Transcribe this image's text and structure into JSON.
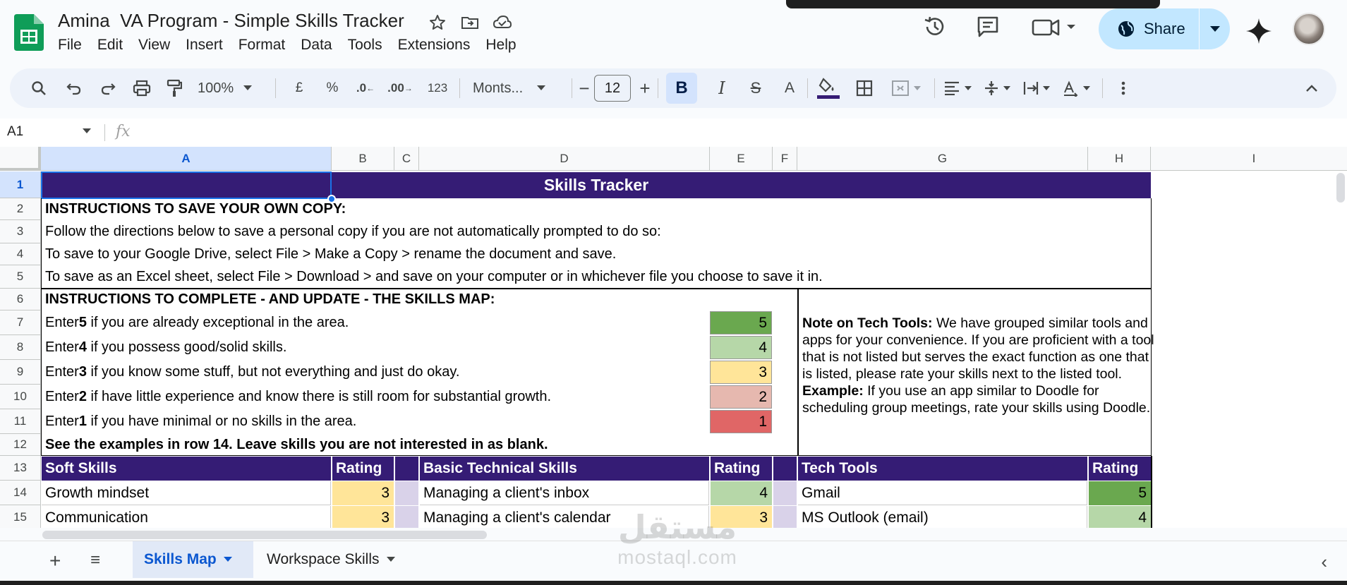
{
  "app": {
    "title": "Amina  VA Program - Simple Skills Tracker",
    "menu": [
      "File",
      "Edit",
      "View",
      "Insert",
      "Format",
      "Data",
      "Tools",
      "Extensions",
      "Help"
    ],
    "share_label": "Share"
  },
  "toolbar": {
    "zoom": "100%",
    "currency": "£",
    "percent": "%",
    "dec_less": ".0",
    "dec_more": ".00",
    "number_format": "123",
    "font": "Monts...",
    "font_size": "12",
    "bold": "B",
    "italic": "I",
    "strike": "S",
    "textcolor": "A"
  },
  "formula": {
    "name_box": "A1",
    "fx": "fx",
    "content": ""
  },
  "columns": [
    "A",
    "B",
    "C",
    "D",
    "E",
    "F",
    "G",
    "H",
    "I"
  ],
  "rows": [
    "1",
    "2",
    "3",
    "4",
    "5",
    "6",
    "7",
    "8",
    "9",
    "10",
    "11",
    "12",
    "13",
    "14",
    "15"
  ],
  "sheet": {
    "title": "Skills Tracker",
    "r2": "INSTRUCTIONS TO SAVE YOUR OWN COPY:",
    "r3": "Follow the directions below to save a personal copy if you are not automatically prompted to do so:",
    "r4": "To save to your Google Drive, select File > Make a Copy > rename the document and save.",
    "r5": "To save as an Excel sheet, select File > Download > and save on your computer or in whichever file you choose to save it in.",
    "r6": "INSTRUCTIONS TO COMPLETE - AND UPDATE - THE SKILLS MAP:",
    "levels": [
      {
        "pre": "Enter ",
        "num": "5",
        "post": " if you are already exceptional in the area.",
        "value": "5"
      },
      {
        "pre": "Enter ",
        "num": "4",
        "post": " if you possess good/solid skills.",
        "value": "4"
      },
      {
        "pre": "Enter ",
        "num": "3",
        "post": " if you know some stuff, but not everything and just do okay.",
        "value": "3"
      },
      {
        "pre": "Enter ",
        "num": "2",
        "post": " if have little experience and know there is still room for substantial growth.",
        "value": "2"
      },
      {
        "pre": "Enter ",
        "num": "1",
        "post": " if you have minimal or no skills in the area.",
        "value": "1"
      }
    ],
    "r12": "See the examples in row 14. Leave skills you are not interested in as blank.",
    "note_title": "Note on Tech Tools:",
    "note_body": " We have grouped similar tools and apps for your convenience. If you are proficient with a tool that is not listed but serves the exact function as one that is listed, please rate your skills next to the listed tool.",
    "example_title": "Example:",
    "example_body": " If you use an app similar to Doodle for scheduling group meetings, rate your skills using Doodle.",
    "headers": {
      "soft": "Soft Skills",
      "rating1": "Rating",
      "basic": "Basic Technical Skills",
      "rating2": "Rating",
      "tools": "Tech Tools",
      "rating3": "Rating"
    },
    "r14": {
      "soft": "Growth mindset",
      "soft_rating": "3",
      "basic": "Managing a client's inbox",
      "basic_rating": "4",
      "tool": "Gmail",
      "tool_rating": "5"
    },
    "r15": {
      "soft": "Communication",
      "soft_rating": "3",
      "basic": "Managing a client's calendar",
      "basic_rating": "3",
      "tool": "MS Outlook (email)",
      "tool_rating": "4"
    }
  },
  "tabs": {
    "active": "Skills Map",
    "inactive": "Workspace Skills"
  },
  "watermark": {
    "line1": "مستقل",
    "line2": "mostaql.com"
  },
  "colors": {
    "header_purple": "#351c75",
    "rating5": "#6aa84f",
    "rating4": "#b6d7a8",
    "rating3": "#ffe599",
    "rating2": "#e6b8af",
    "rating1": "#e06666",
    "spacer": "#d9d2e9"
  }
}
